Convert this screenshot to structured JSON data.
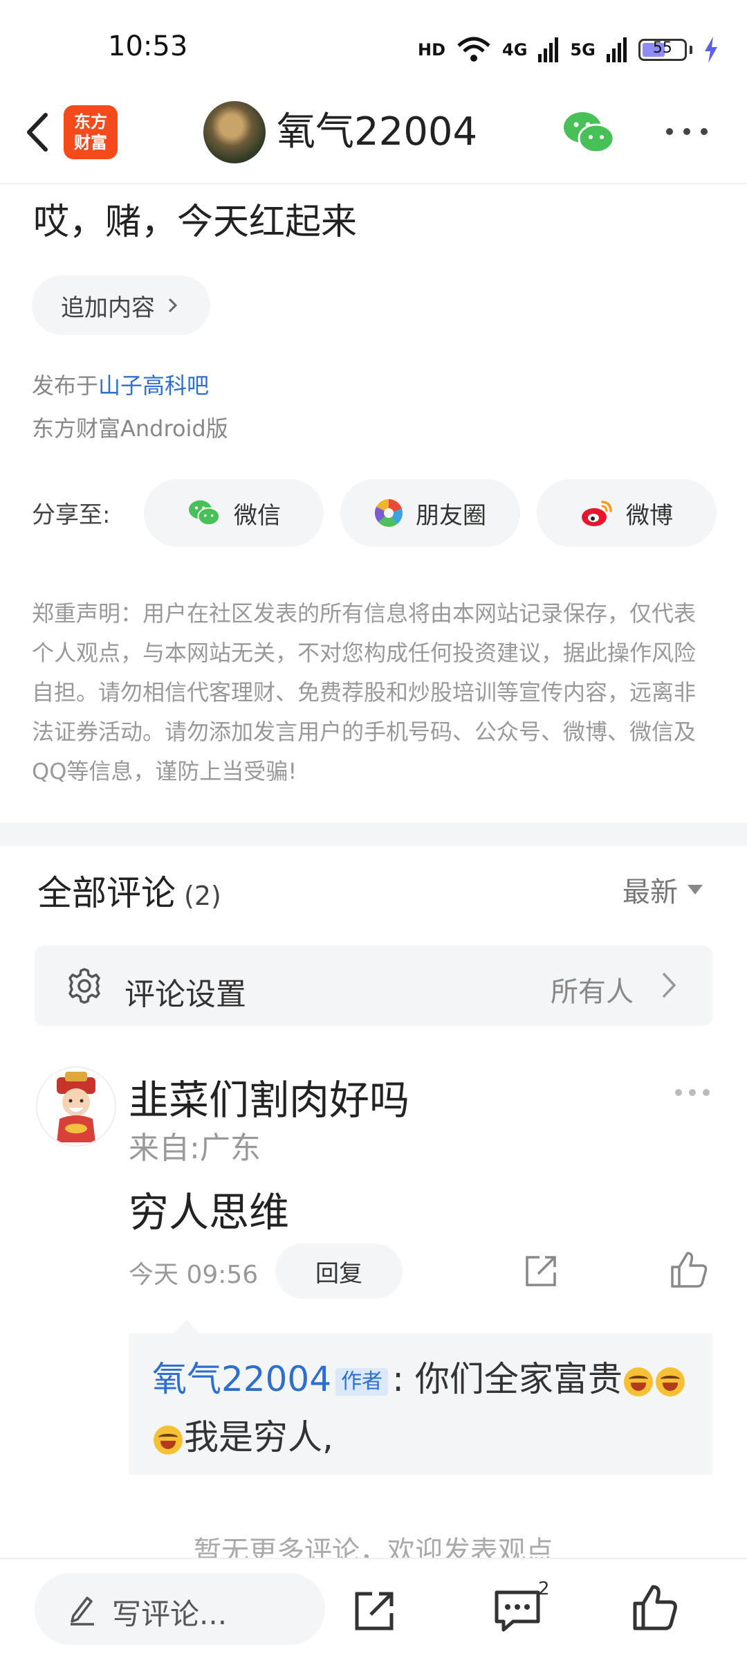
{
  "status_bar": {
    "time": "10:53",
    "hd_label": "HD",
    "net_4g": "4G",
    "net_5g": "5G",
    "battery": "55",
    "battery_level": 0.55
  },
  "nav": {
    "logo_text": "东方\n财富",
    "title": "氧气22004",
    "icons": [
      "back-icon",
      "wechat-icon",
      "more-icon"
    ]
  },
  "post": {
    "text": "哎，赌，今天红起来",
    "append_label": "追加内容",
    "published_prefix": "发布于",
    "forum": "山子高科吧",
    "client": "东方财富Android版"
  },
  "share": {
    "label": "分享至:",
    "wechat": "微信",
    "moments": "朋友圈",
    "weibo": "微博"
  },
  "disclaimer": "郑重声明：用户在社区发表的所有信息将由本网站记录保存，仅代表个人观点，与本网站无关，不对您构成任何投资建议，据此操作风险自担。请勿相信代客理财、免费荐股和炒股培训等宣传内容，远离非法证券活动。请勿添加发言用户的手机号码、公众号、微博、微信及QQ等信息，谨防上当受骗!",
  "comments": {
    "title": "全部评论",
    "count": "(2)",
    "sort": "最新",
    "settings_label": "评论设置",
    "settings_value": "所有人"
  },
  "comment": {
    "user": "韭菜们割肉好吗",
    "location": "来自:广东",
    "text": "穷人思维",
    "time": "今天 09:56",
    "reply_label": "回复"
  },
  "reply": {
    "user": "氧气22004",
    "tag": "作者",
    "sep": ":",
    "text_1": "你们全家富贵",
    "text_2": "我是穷人,"
  },
  "no_more": "暂无更多评论，欢迎发表观点",
  "bottom_bar": {
    "write_label": "写评论...",
    "comment_count": "2"
  },
  "colors": {
    "accent_blue": "#2d6fd0",
    "brand_orange": "#f44a1c",
    "wechat_green": "#48c058"
  }
}
